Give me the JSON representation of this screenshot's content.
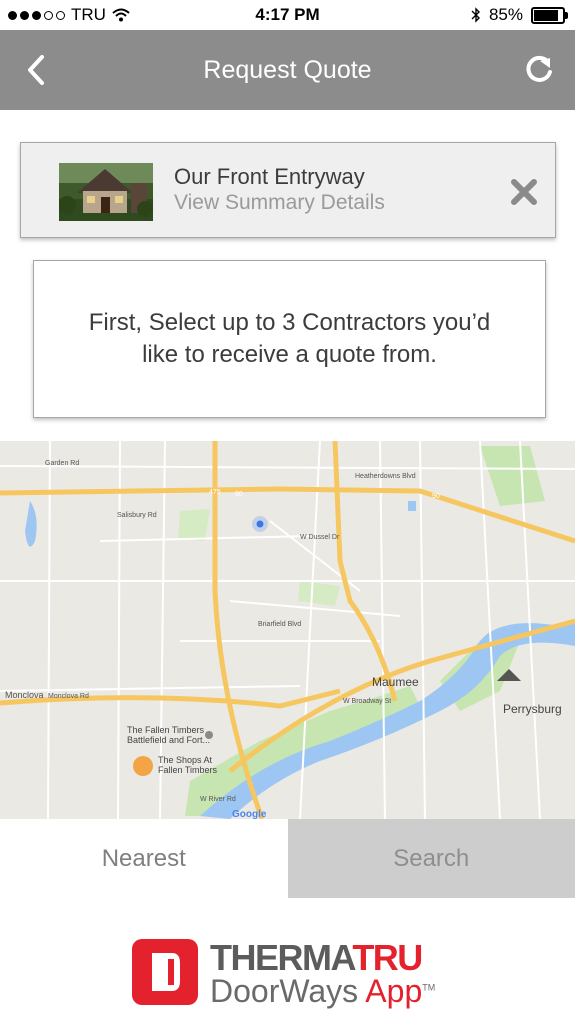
{
  "status_bar": {
    "carrier": "TRU",
    "time": "4:17 PM",
    "battery": "85%"
  },
  "header": {
    "title": "Request Quote"
  },
  "summary_card": {
    "title": "Our Front Entryway",
    "subtitle": "View Summary Details"
  },
  "instruction": {
    "text": "First, Select up to 3 Contractors you’d like to receive a quote from."
  },
  "map": {
    "labels": {
      "maumee": "Maumee",
      "perrysburg": "Perrysburg",
      "fallen_timbers_1": "The Fallen Timbers",
      "fallen_timbers_2": "Battlefield and Fort...",
      "shops_1": "The Shops At",
      "shops_2": "Fallen Timbers",
      "monclova": "Monclova",
      "monclova_rd": "Monclova Rd",
      "garden_rd": "Garden Rd",
      "heatherdowns": "Heatherdowns Blvd",
      "dussel": "W Dussel Dr",
      "briarfield": "Briarfield Blvd",
      "salisbury": "Salisbury Rd",
      "wbroadway": "W Broadway St",
      "wriver": "W River Rd",
      "i475": "475",
      "i80": "80",
      "i90": "90",
      "google": "Google"
    }
  },
  "tabs": {
    "nearest": "Nearest",
    "search": "Search"
  },
  "logo": {
    "brand_left": "THERMA",
    "brand_right": "TRU",
    "app_left": "DoorWays ",
    "app_right": "App",
    "tm": "TM"
  },
  "colors": {
    "navbar": "#8c8c8c",
    "brand_red": "#e3222e",
    "water": "#9ec6f2",
    "park": "#c6e5b0",
    "highway": "#f6c760"
  }
}
